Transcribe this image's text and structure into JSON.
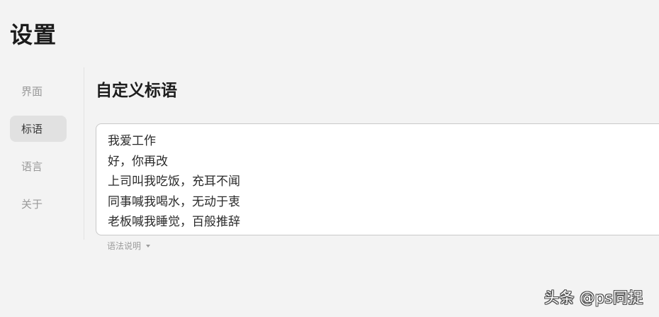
{
  "page": {
    "title": "设置"
  },
  "sidebar": {
    "items": [
      {
        "label": "界面",
        "active": false
      },
      {
        "label": "标语",
        "active": true
      },
      {
        "label": "语言",
        "active": false
      },
      {
        "label": "关于",
        "active": false
      }
    ]
  },
  "main": {
    "section_title": "自定义标语",
    "slogan_lines": [
      "我爱工作",
      "好，你再改",
      "上司叫我吃饭，充耳不闻",
      "同事喊我喝水，无动于衷",
      "老板喊我睡觉，百般推辞"
    ],
    "syntax_help": "语法说明",
    "syntax_help_icon": "caret-down-icon"
  },
  "watermark": {
    "text": "头条 @ps同捉"
  },
  "colors": {
    "background": "#f3f3f3",
    "active_nav_bg": "#e1e1e1",
    "editor_border": "#c9c9c9",
    "muted_text": "#9a9a9a"
  }
}
